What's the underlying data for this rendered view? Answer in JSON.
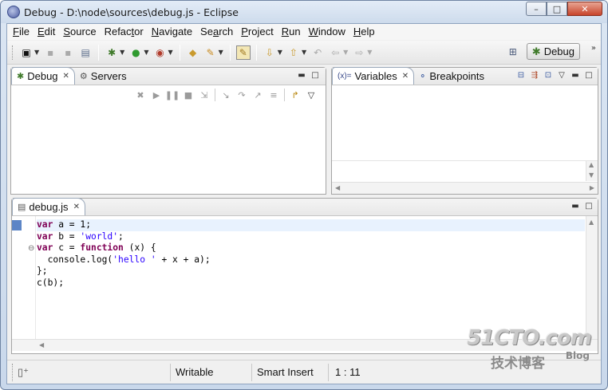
{
  "window": {
    "title": "Debug - D:\\node\\sources\\debug.js - Eclipse",
    "controls": {
      "minimize": "–",
      "maximize": "□",
      "close": "✕"
    }
  },
  "menubar": {
    "items": [
      {
        "underline": "F",
        "rest": "ile"
      },
      {
        "underline": "E",
        "rest": "dit"
      },
      {
        "underline": "S",
        "rest": "ource"
      },
      {
        "pre": "Refac",
        "underline": "t",
        "rest": "or"
      },
      {
        "underline": "N",
        "rest": "avigate"
      },
      {
        "pre": "Se",
        "underline": "a",
        "rest": "rch"
      },
      {
        "underline": "P",
        "rest": "roject"
      },
      {
        "underline": "R",
        "rest": "un"
      },
      {
        "underline": "W",
        "rest": "indow"
      },
      {
        "underline": "H",
        "rest": "elp"
      }
    ]
  },
  "toolbar": {
    "perspective_label": "Debug",
    "chevron": "»"
  },
  "debug_view": {
    "tabs": [
      {
        "label": "Debug",
        "icon": "debug-bug-icon",
        "active": true,
        "closable": true
      },
      {
        "label": "Servers",
        "icon": "servers-icon",
        "active": false,
        "closable": false
      }
    ]
  },
  "variables_view": {
    "tabs": [
      {
        "label": "Variables",
        "icon": "variables-icon",
        "icon_text": "(x)=",
        "active": true,
        "closable": true
      },
      {
        "label": "Breakpoints",
        "icon": "breakpoints-icon",
        "active": false,
        "closable": false
      }
    ]
  },
  "editor": {
    "tab_label": "debug.js",
    "lines": [
      [
        {
          "t": "var",
          "c": "kw"
        },
        {
          "t": " a = 1;"
        }
      ],
      [
        {
          "t": "var",
          "c": "kw"
        },
        {
          "t": " b = "
        },
        {
          "t": "'world'",
          "c": "str"
        },
        {
          "t": ";"
        }
      ],
      [
        {
          "t": "var",
          "c": "kw"
        },
        {
          "t": " c = "
        },
        {
          "t": "function",
          "c": "kw"
        },
        {
          "t": " (x) {"
        }
      ],
      [
        {
          "t": "  console.log("
        },
        {
          "t": "'hello '",
          "c": "str"
        },
        {
          "t": " + x + a);"
        }
      ],
      [
        {
          "t": "};"
        }
      ],
      [
        {
          "t": "c(b);"
        }
      ]
    ],
    "current_line": 1
  },
  "statusbar": {
    "writable": "Writable",
    "insert_mode": "Smart Insert",
    "position": "1 : 11"
  },
  "watermark": {
    "main": "51CTO.com",
    "sub": "技术博客",
    "blog": "Blog"
  },
  "colors": {
    "keyword": "#7f0055",
    "string": "#2a00ff",
    "current_line_bg": "#e8f2fe",
    "gutter_marker": "#5d85c6"
  }
}
